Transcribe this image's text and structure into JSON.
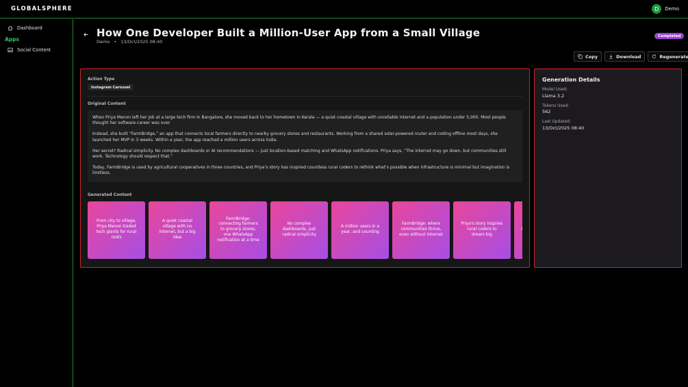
{
  "app": {
    "logo": "GLOBALSPHERE",
    "user_initial": "D",
    "user_name": "Demo"
  },
  "sidebar": {
    "dashboard_label": "Dashboard",
    "section_label": "Apps",
    "social_label": "Social Content"
  },
  "header": {
    "title": "How One Developer Built a Million-User App from a Small Village",
    "author": "Demo",
    "separator": "•",
    "date": "13/Oct/2025 08:40",
    "status": "Completed"
  },
  "actions": {
    "copy": "Copy",
    "download": "Download",
    "regenerate": "Regenerate"
  },
  "content": {
    "action_type_label": "Action Type",
    "action_type_value": "Instagram Carousel",
    "original_label": "Original Content",
    "paragraphs": [
      "When Priya Menon left her job at a large tech firm in Bangalore, she moved back to her hometown in Kerala — a quiet coastal village with unreliable internet and a population under 5,000. Most people thought her software career was over.",
      "Instead, she built “FarmBridge,” an app that connects local farmers directly to nearby grocery stores and restaurants. Working from a shared solar-powered router and coding offline most days, she launched her MVP in 3 weeks. Within a year, the app reached a million users across India.",
      "Her secret? Radical simplicity. No complex dashboards or AI recommendations — just location-based matching and WhatsApp notifications. Priya says, “The internet may go down, but communities still work. Technology should respect that.”",
      "Today, FarmBridge is used by agricultural cooperatives in three countries, and Priya’s story has inspired countless rural coders to rethink what’s possible when infrastructure is minimal but imagination is limitless."
    ],
    "generated_label": "Generated Content",
    "slides": [
      "From city to village, Priya Menon traded tech giants for rural roots",
      "A quiet coastal village with no internet, but a big idea",
      "FarmBridge: connecting farmers to grocery stores, one WhatsApp notification at a time",
      "No complex dashboards, just radical simplicity",
      "A million users in a year, and counting",
      "FarmBridge: where communities thrive, even without internet",
      "Priya's story inspires rural coders to dream big",
      "Limitless imagination, minimal infrastructure"
    ]
  },
  "details": {
    "title": "Generation Details",
    "model_label": "Model Used:",
    "model_value": "Llama 3.2",
    "tokens_label": "Tokens Used:",
    "tokens_value": "562",
    "updated_label": "Last Updated:",
    "updated_value": "13/Oct/2025 08:40"
  },
  "colors": {
    "accent_green": "#1e8a3a",
    "panel_border": "#d1242f",
    "status_purple": "#9d3fd8",
    "card_gradient_start": "#e9469a",
    "card_gradient_end": "#a64ee6"
  }
}
